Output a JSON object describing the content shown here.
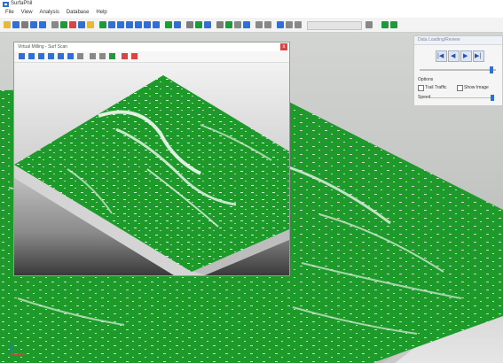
{
  "window": {
    "title": "SurfaPhil"
  },
  "menu": [
    "File",
    "View",
    "Analysis",
    "Database",
    "Help"
  ],
  "toolbar": {
    "icons": [
      "open-icon",
      "save-icon",
      "print-icon",
      "undo-icon",
      "redo-icon",
      "cursor-icon",
      "zoom-icon",
      "pan-icon",
      "rotate-icon",
      "measure-icon",
      "grid-icon",
      "palette-icon",
      "light-icon",
      "layer-icon",
      "view-icon",
      "export-icon",
      "color-icon",
      "settings-icon",
      "filter-icon",
      "surface-icon",
      "chart-icon",
      "info-icon"
    ],
    "colors": {
      "blue": "#2f6fd6",
      "green": "#1f9a3b",
      "red": "#d84545",
      "yellow": "#e6b93a",
      "gray": "#7d7d7d"
    }
  },
  "play_panel": {
    "title": "Data Loading/Review",
    "buttons": [
      "|◀",
      "◀",
      "▶",
      "▶|"
    ],
    "section_label": "Options",
    "checkboxes": [
      {
        "label": "Trail Traffic",
        "checked": false
      },
      {
        "label": "Show Image",
        "checked": false
      }
    ],
    "speed_label": "Speed"
  },
  "child_window": {
    "title": "Virtual Milling - Surf Scan",
    "close_label": "x"
  },
  "colors": {
    "surface_green": "#1d9a2a",
    "base_gray": "#cfcfcf"
  }
}
